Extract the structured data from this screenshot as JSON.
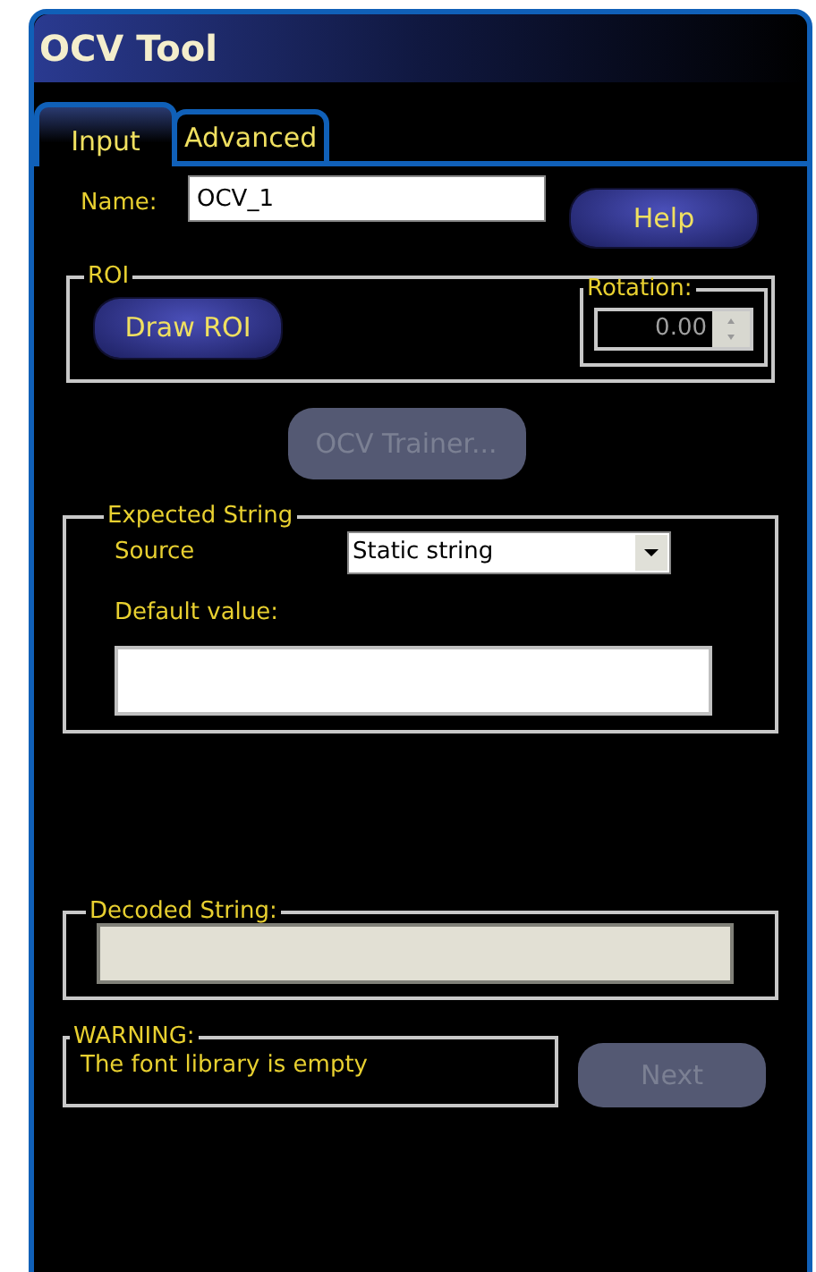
{
  "window": {
    "title": "OCV Tool"
  },
  "tabs": [
    {
      "label": "Input",
      "selected": true
    },
    {
      "label": "Advanced",
      "selected": false
    }
  ],
  "name_field": {
    "label": "Name:",
    "value": "OCV_1"
  },
  "help_button": {
    "label": "Help",
    "disabled": false
  },
  "roi": {
    "title": "ROI",
    "draw_button": {
      "label": "Draw ROI",
      "disabled": false
    },
    "rotation": {
      "title": "Rotation:",
      "value": "0.00",
      "disabled": true
    }
  },
  "trainer_button": {
    "label": "OCV Trainer...",
    "disabled": true
  },
  "expected_string": {
    "title": "Expected String",
    "source_label": "Source",
    "source_value": "Static string",
    "default_label": "Default value:"
  },
  "decoded_string": {
    "title": "Decoded String:",
    "disabled": true
  },
  "warning": {
    "title": "WARNING:",
    "message": "The font library is empty"
  },
  "next_button": {
    "label": "Next",
    "disabled": true
  }
}
